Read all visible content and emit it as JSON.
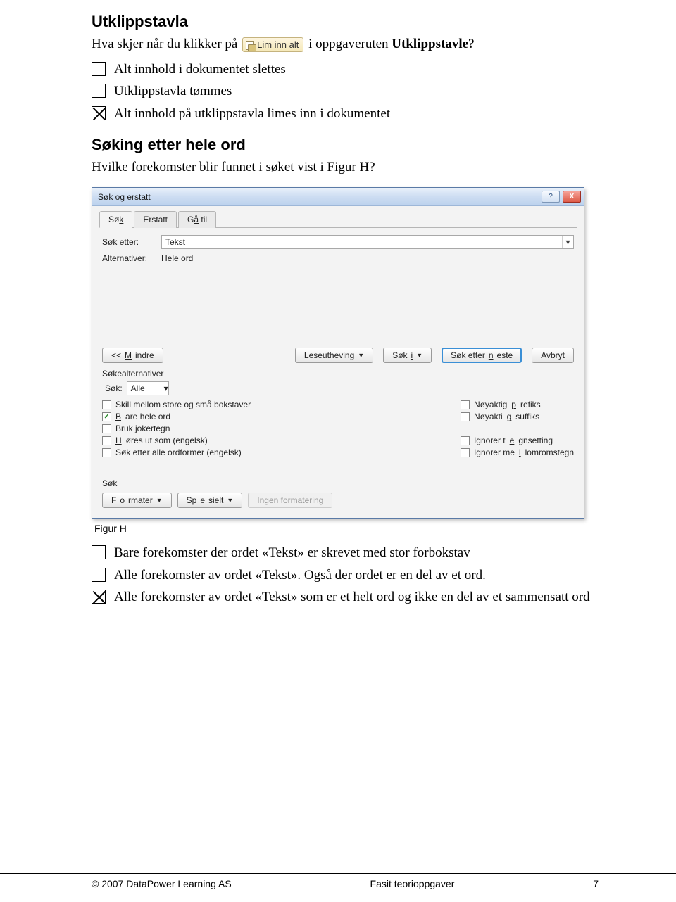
{
  "section1": {
    "title": "Utklippstavla",
    "question_prefix": "Hva skjer når du klikker på ",
    "inline_button_label": "Lim inn alt",
    "question_suffix": " i oppgaveruten ",
    "question_bold_term": "Utklippstavle",
    "question_end": "?"
  },
  "choices1": [
    {
      "text": "Alt innhold i dokumentet slettes",
      "checked": false
    },
    {
      "text": "Utklippstavla tømmes",
      "checked": false
    },
    {
      "text": "Alt innhold på utklippstavla limes inn i dokumentet",
      "checked": true
    }
  ],
  "section2": {
    "title": "Søking etter hele ord",
    "question": "Hvilke forekomster blir funnet i søket vist i Figur H?"
  },
  "dialog": {
    "title": "Søk og erstatt",
    "help_icon": "?",
    "close_icon": "X",
    "tabs": [
      {
        "label": "Søk",
        "ukey": "k",
        "active": true
      },
      {
        "label": "Erstatt",
        "ukey": "",
        "active": false
      },
      {
        "label": "Gå til",
        "ukey": "å",
        "active": false
      }
    ],
    "search_label": "Søk etter:",
    "search_value": "Tekst",
    "alt_label": "Alternativer:",
    "alt_value": "Hele ord",
    "buttons": {
      "less": "<< Mindre",
      "highlight": "Leseutheving",
      "search_in": "Søk i",
      "find_next": "Søk etter neste",
      "cancel": "Avbryt"
    },
    "options_title": "Søkealternativer",
    "direction_label": "Søk:",
    "direction_value": "Alle",
    "checks_left": [
      {
        "label": "Skill mellom store og små bokstaver",
        "on": false
      },
      {
        "label": "Bare hele ord",
        "on": true
      },
      {
        "label": "Bruk jokertegn",
        "on": false
      },
      {
        "label": "Høres ut som (engelsk)",
        "on": false
      },
      {
        "label": "Søk etter alle ordformer (engelsk)",
        "on": false
      }
    ],
    "checks_right": [
      {
        "label": "Nøyaktig prefiks",
        "on": false
      },
      {
        "label": "Nøyaktig suffiks",
        "on": false
      },
      {
        "label": "Ignorer tegnsetting",
        "on": false
      },
      {
        "label": "Ignorer mellomromstegn",
        "on": false
      }
    ],
    "group_title": "Søk",
    "format_btn": "Formater",
    "special_btn": "Spesielt",
    "noformat_btn": "Ingen formatering"
  },
  "caption": "Figur H",
  "choices2": [
    {
      "text": "Bare forekomster der ordet «Tekst» er skrevet med stor forbokstav",
      "checked": false
    },
    {
      "text": "Alle forekomster av ordet «Tekst». Også der ordet er en del av et ord.",
      "checked": false
    },
    {
      "text": "Alle forekomster av ordet «Tekst» som er et helt ord og ikke en del av et sammensatt ord",
      "checked": true
    }
  ],
  "footer": {
    "left": "© 2007 DataPower Learning AS",
    "center": "Fasit teorioppgaver",
    "right": "7"
  }
}
